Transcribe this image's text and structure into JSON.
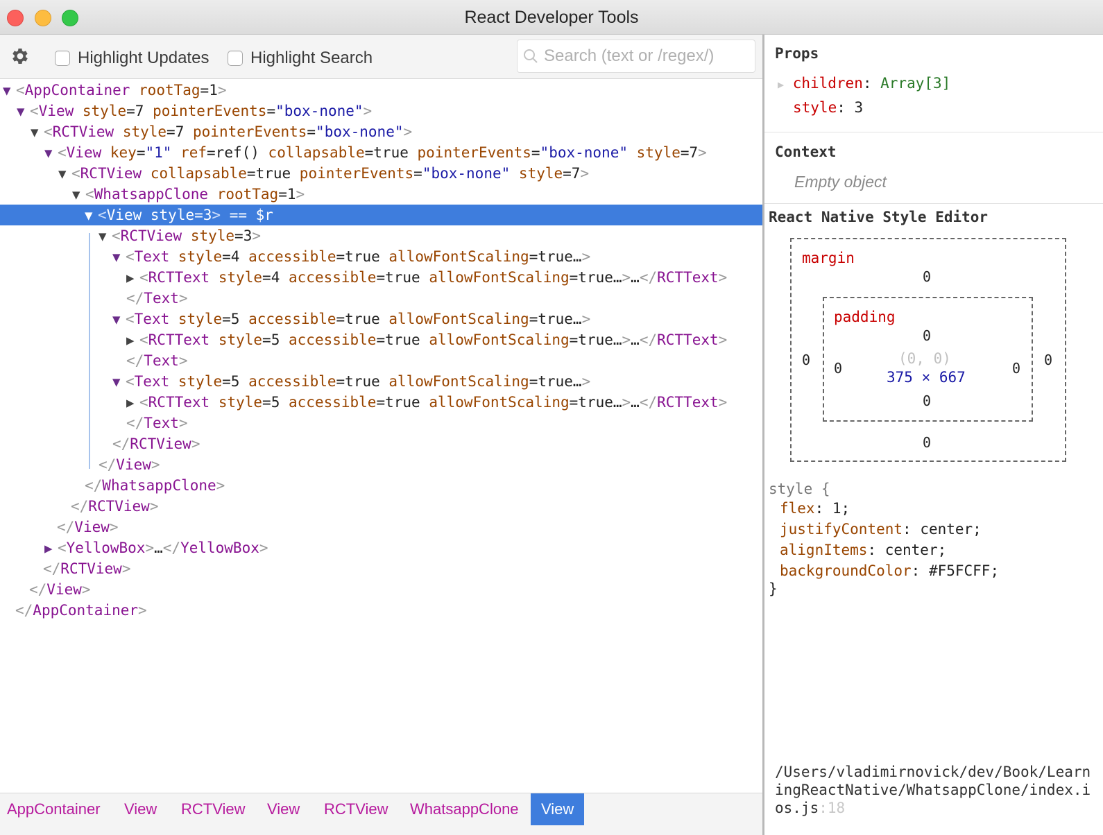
{
  "window": {
    "title": "React Developer Tools"
  },
  "toolbar": {
    "highlight_updates": "Highlight Updates",
    "highlight_search": "Highlight Search",
    "search_placeholder": "Search (text or /regex/)"
  },
  "tree": {
    "r0": {
      "tag": "AppContainer",
      "a1": "rootTag",
      "v1": "1"
    },
    "r1": {
      "tag": "View",
      "a1": "style",
      "v1": "7",
      "a2": "pointerEvents",
      "s2": "\"box-none\""
    },
    "r2": {
      "tag": "RCTView",
      "a1": "style",
      "v1": "7",
      "a2": "pointerEvents",
      "s2": "\"box-none\""
    },
    "r3": {
      "tag": "View",
      "a1": "key",
      "s1": "\"1\"",
      "a2": "ref",
      "v2": "ref()",
      "a3": "collapsable",
      "v3": "true",
      "a4": "pointerEvents",
      "s4": "\"box-none\"",
      "a5": "style",
      "v5": "7"
    },
    "r4": {
      "tag": "RCTView",
      "a1": "collapsable",
      "v1": "true",
      "a2": "pointerEvents",
      "s2": "\"box-none\"",
      "a3": "style",
      "v3": "7"
    },
    "r5": {
      "tag": "WhatsappClone",
      "a1": "rootTag",
      "v1": "1"
    },
    "r6": {
      "tag": "View",
      "a1": "style",
      "v1": "3",
      "suffix": " == $r"
    },
    "r7": {
      "tag": "RCTView",
      "a1": "style",
      "v1": "3"
    },
    "r8": {
      "tag": "Text",
      "a1": "style",
      "v1": "4",
      "a2": "accessible",
      "v2": "true",
      "a3": "allowFontScaling",
      "v3": "true…"
    },
    "r9": {
      "tag": "RCTText",
      "a1": "style",
      "v1": "4",
      "a2": "accessible",
      "v2": "true",
      "a3": "allowFontScaling",
      "v3": "true…",
      "mid": "…"
    },
    "r10": {
      "tag": "Text"
    },
    "r11": {
      "tag": "Text",
      "a1": "style",
      "v1": "5",
      "a2": "accessible",
      "v2": "true",
      "a3": "allowFontScaling",
      "v3": "true…"
    },
    "r12": {
      "tag": "RCTText",
      "a1": "style",
      "v1": "5",
      "a2": "accessible",
      "v2": "true",
      "a3": "allowFontScaling",
      "v3": "true…",
      "mid": "…"
    },
    "r13": {
      "tag": "Text"
    },
    "r14": {
      "tag": "Text",
      "a1": "style",
      "v1": "5",
      "a2": "accessible",
      "v2": "true",
      "a3": "allowFontScaling",
      "v3": "true…"
    },
    "r15": {
      "tag": "RCTText",
      "a1": "style",
      "v1": "5",
      "a2": "accessible",
      "v2": "true",
      "a3": "allowFontScaling",
      "v3": "true…",
      "mid": "…"
    },
    "r16": {
      "tag": "Text"
    },
    "r17": {
      "tag": "RCTView"
    },
    "r18": {
      "tag": "View"
    },
    "r19": {
      "tag": "WhatsappClone"
    },
    "r20": {
      "tag": "RCTView"
    },
    "r21": {
      "tag": "View"
    },
    "r22": {
      "tag": "YellowBox",
      "mid": "…"
    },
    "r23": {
      "tag": "RCTView"
    },
    "r24": {
      "tag": "View"
    },
    "r25": {
      "tag": "AppContainer"
    }
  },
  "breadcrumbs": [
    "AppContainer",
    "View",
    "RCTView",
    "View",
    "RCTView",
    "WhatsappClone",
    "View"
  ],
  "props": {
    "heading": "Props",
    "children_key": "children",
    "children_val": "Array[3]",
    "style_key": "style",
    "style_val": "3"
  },
  "context": {
    "heading": "Context",
    "empty": "Empty object"
  },
  "style_editor": {
    "heading": "React Native Style Editor",
    "margin_label": "margin",
    "padding_label": "padding",
    "margin_top": "0",
    "margin_left": "0",
    "margin_right": "0",
    "margin_bottom": "0",
    "padding_top": "0",
    "padding_left": "0",
    "padding_right": "0",
    "padding_bottom": "0",
    "position": "(0, 0)",
    "dimensions": "375 × 667"
  },
  "style_rules": {
    "selector": "style {",
    "close": "}",
    "rules": [
      {
        "key": "flex",
        "val": "1;"
      },
      {
        "key": "justifyContent",
        "val": "center;"
      },
      {
        "key": "alignItems",
        "val": "center;"
      },
      {
        "key": "backgroundColor",
        "val": "#F5FCFF;"
      }
    ]
  },
  "source": {
    "path": "/Users/vladimirnovick/dev/Book/LearningReactNative/WhatsappClone/index.ios.js",
    "line": ":18"
  },
  "colors": {
    "selection": "#3e7ddd",
    "tag": "#881391",
    "attr": "#994500",
    "string": "#1a1aa6"
  }
}
